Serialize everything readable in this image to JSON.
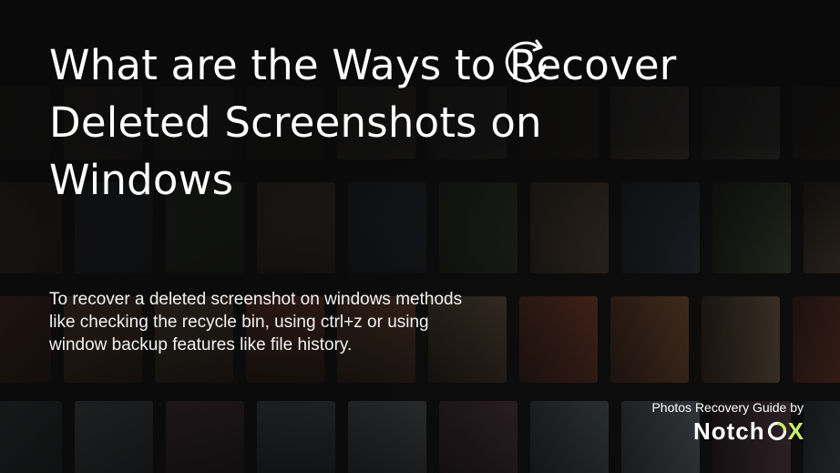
{
  "banner": {
    "title_line1_prefix": "What are the Ways to ",
    "title_line1_word": "Recover",
    "title_line2": "Deleted Screenshots on",
    "title_line3": "Windows",
    "description": "To recover a deleted screenshot on windows methods like checking the recycle bin, using ctrl+z or using window backup features like file history.",
    "credit_text": "Photos Recovery Guide by",
    "brand_name_main": "Notch",
    "brand_name_x": "X",
    "colors": {
      "background": "#0d0d0d",
      "text": "#ffffff",
      "brand_accent": "#c7ee6c"
    },
    "icons": [
      "recover-arrow-icon",
      "notchox-o-icon"
    ],
    "background_image": "blurred grid of photo thumbnails"
  }
}
